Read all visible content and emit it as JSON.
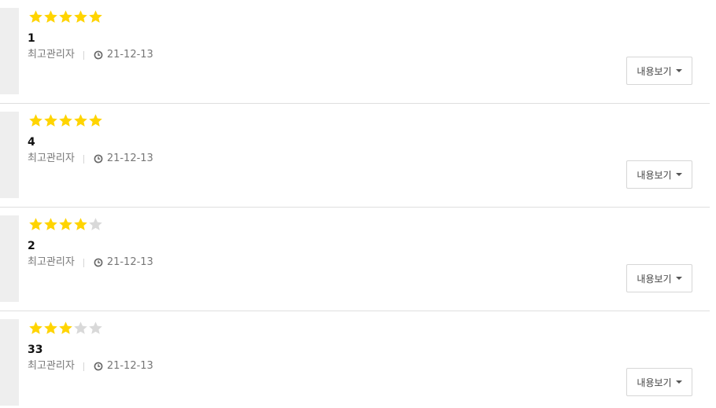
{
  "colors": {
    "star_on": "#FFD400",
    "star_off": "#D9D9D9"
  },
  "reviews": [
    {
      "rating": 5,
      "title": "1",
      "author": "최고관리자",
      "date": "21-12-13",
      "button_label": "내용보기"
    },
    {
      "rating": 5,
      "title": "4",
      "author": "최고관리자",
      "date": "21-12-13",
      "button_label": "내용보기"
    },
    {
      "rating": 4,
      "title": "2",
      "author": "최고관리자",
      "date": "21-12-13",
      "button_label": "내용보기"
    },
    {
      "rating": 3,
      "title": "33",
      "author": "최고관리자",
      "date": "21-12-13",
      "button_label": "내용보기"
    }
  ],
  "icons": {
    "star": "star-icon",
    "clock": "clock-icon",
    "caret": "caret-down-icon"
  }
}
